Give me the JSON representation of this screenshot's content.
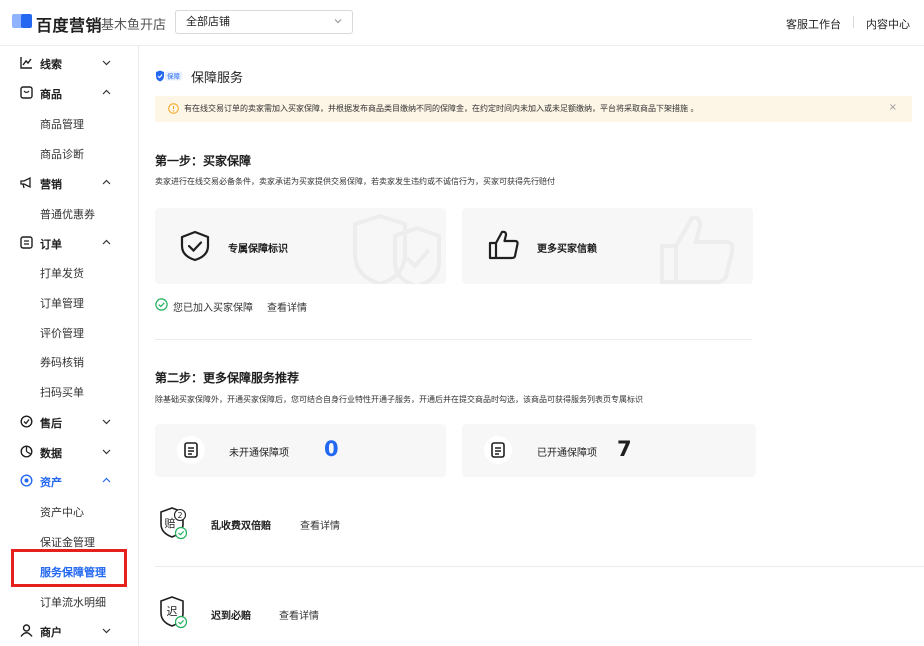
{
  "header": {
    "logo_text": "百度营销",
    "store_name": "基木鱼开店",
    "store_select_value": "全部店铺",
    "links": [
      "客服工作台",
      "内容中心"
    ]
  },
  "sidebar": {
    "groups": [
      {
        "label": "线索",
        "icon": "chart-icon",
        "expanded": false
      },
      {
        "label": "商品",
        "icon": "box-icon",
        "expanded": true,
        "items": [
          "商品管理",
          "商品诊断"
        ]
      },
      {
        "label": "营销",
        "icon": "megaphone-icon",
        "expanded": true,
        "items": [
          "普通优惠券"
        ]
      },
      {
        "label": "订单",
        "icon": "order-icon",
        "expanded": true,
        "items": [
          "打单发货",
          "订单管理",
          "评价管理",
          "券码核销",
          "扫码买单"
        ]
      },
      {
        "label": "售后",
        "icon": "aftersale-icon",
        "expanded": false
      },
      {
        "label": "数据",
        "icon": "data-icon",
        "expanded": false
      },
      {
        "label": "资产",
        "icon": "asset-icon",
        "expanded": true,
        "active": true,
        "items": [
          "资产中心",
          "保证金管理",
          "服务保障管理",
          "订单流水明细"
        ],
        "active_item": "服务保障管理"
      },
      {
        "label": "商户",
        "icon": "merchant-icon",
        "expanded": false
      }
    ]
  },
  "main": {
    "badge": "保障",
    "title": "保障服务",
    "notice": "有在线交易订单的卖家需加入买家保障，并根据发布商品类目缴纳不同的保障金，在约定时间内未加入或未足额缴纳，平台将采取商品下架措施 。",
    "notice_close": "×",
    "step1": {
      "title": "第一步：买家保障",
      "desc": "卖家进行在线交易必备条件，卖家承诺为买家提供交易保障，若卖家发生违约或不诚信行为，买家可获得先行赔付",
      "cards": [
        {
          "label": "专属保障标识",
          "icon": "shield-check-icon"
        },
        {
          "label": "更多买家信赖",
          "icon": "thumbs-up-icon"
        }
      ],
      "joined_text": "您已加入买家保障",
      "joined_link": "查看详情"
    },
    "step2": {
      "title": "第二步：更多保障服务推荐",
      "desc": "除基础买家保障外，开通买家保障后，您可结合自身行业特性开通子服务，开通后并在提交商品时勾选，该商品可获得服务列表页专属标识",
      "stats": [
        {
          "label": "未开通保障项",
          "value": "0",
          "color": "#2468f2"
        },
        {
          "label": "已开通保障项",
          "value": "7",
          "color": "#1f1f1f"
        }
      ],
      "services": [
        {
          "name": "乱收费双倍赔",
          "link": "查看详情",
          "icon_text": "赔",
          "icon_badge": "2"
        },
        {
          "name": "迟到必赔",
          "link": "查看详情",
          "icon_text": "迟",
          "icon_badge": ""
        }
      ]
    }
  },
  "colors": {
    "accent": "#2468f2",
    "success": "#1fb15b",
    "highlight": "#e5201d",
    "notice_bg": "#fdf5e6",
    "warning": "#f5a623"
  }
}
